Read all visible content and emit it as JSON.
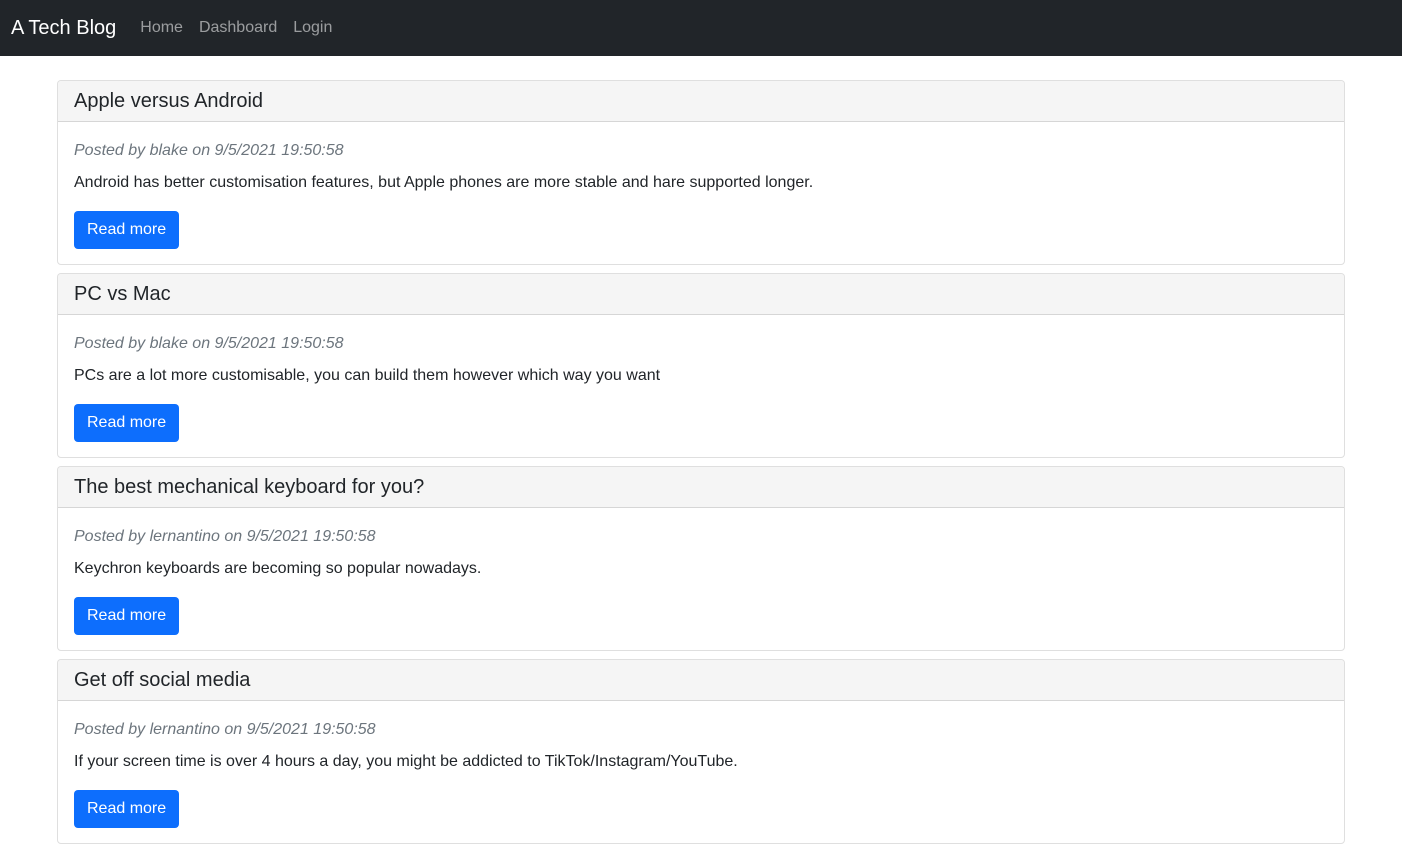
{
  "navbar": {
    "brand": "A Tech Blog",
    "links": [
      "Home",
      "Dashboard",
      "Login"
    ]
  },
  "posts": [
    {
      "title": "Apple versus Android",
      "meta": "Posted by blake on 9/5/2021 19:50:58",
      "content": "Android has better customisation features, but Apple phones are more stable and hare supported longer.",
      "button": "Read more"
    },
    {
      "title": "PC vs Mac",
      "meta": "Posted by blake on 9/5/2021 19:50:58",
      "content": "PCs are a lot more customisable, you can build them however which way you want",
      "button": "Read more"
    },
    {
      "title": "The best mechanical keyboard for you?",
      "meta": "Posted by lernantino on 9/5/2021 19:50:58",
      "content": "Keychron keyboards are becoming so popular nowadays.",
      "button": "Read more"
    },
    {
      "title": "Get off social media",
      "meta": "Posted by lernantino on 9/5/2021 19:50:58",
      "content": "If your screen time is over 4 hours a day, you might be addicted to TikTok/Instagram/YouTube.",
      "button": "Read more"
    }
  ],
  "colors": {
    "navbar_bg": "#212529",
    "primary_button": "#0d6efd",
    "card_header_bg": "#f5f5f5"
  }
}
